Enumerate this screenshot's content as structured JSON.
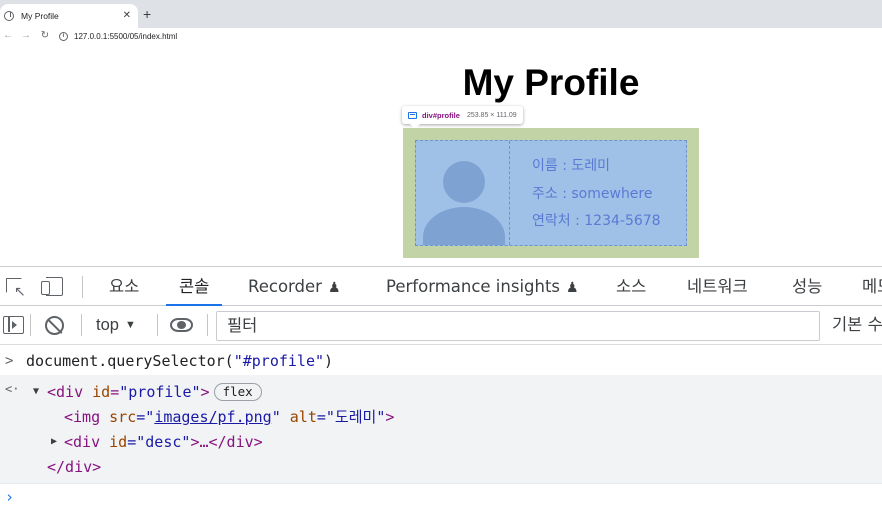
{
  "browser": {
    "tab_title": "My Profile",
    "close_glyph": "✕",
    "new_tab_glyph": "+",
    "back_glyph": "←",
    "forward_glyph": "→",
    "reload_glyph": "↻",
    "info_glyph": "i",
    "url": "127.0.0.1:5500/05/index.html"
  },
  "page": {
    "title": "My Profile",
    "tooltip_selector": "div#profile",
    "tooltip_size": "253.85 × 111.09",
    "desc_lines": [
      "이름 : 도레미",
      "주소 : somewhere",
      "연락처 : 1234-5678"
    ]
  },
  "devtools": {
    "tabs": [
      "요소",
      "콘솔",
      "Recorder",
      "Performance insights",
      "소스",
      "네트워크",
      "성능",
      "메모"
    ],
    "flask_glyph": "♟",
    "selected_tab": "콘솔",
    "context": "top",
    "caret_glyph": "▼",
    "filter_placeholder": "필터",
    "levels_label": "기본 수준"
  },
  "console": {
    "prompt_in": ">",
    "prompt_out": "<·",
    "command_prefix": "document.querySelector(",
    "command_arg": "\"#profile\"",
    "command_suffix": ")",
    "line1": {
      "open": "<div ",
      "attr": "id",
      "eq": "=",
      "val": "\"profile\"",
      "close": ">",
      "badge": "flex"
    },
    "line2": {
      "open": "<img ",
      "attr1": "src",
      "val1_q1": "=\"",
      "val1": "images/pf.png",
      "val1_q2": "\" ",
      "attr2": "alt",
      "val2": "=\"도레미\"",
      "close": ">"
    },
    "line3": {
      "open": "<div ",
      "attr": "id",
      "val": "=\"desc\"",
      "close": ">…</div>"
    },
    "line4": "</div>",
    "expand_open": "▼",
    "expand_closed": "▶",
    "input_prompt": "›"
  },
  "icons": [
    "tab-favicon-icon",
    "close-icon",
    "plus-icon",
    "back-icon",
    "forward-icon",
    "reload-icon",
    "info-icon",
    "inspect-icon",
    "device-toolbar-icon",
    "flask-icon",
    "sidebar-icon",
    "clear-console-icon",
    "eye-icon",
    "chevron-down-icon"
  ],
  "colors": {
    "margin_overlay": "#c2d4a6",
    "content_overlay": "#9fc1e8",
    "accent": "#1a73e8",
    "tag": "#881280",
    "attribute": "#994500",
    "string": "#1a1aa6"
  }
}
